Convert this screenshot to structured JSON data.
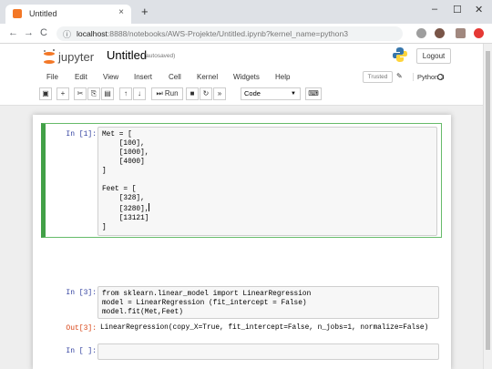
{
  "browser": {
    "tab_title": "Untitled",
    "tab_close": "×",
    "new_tab": "+",
    "window_controls": [
      "–",
      "☐",
      "✕"
    ],
    "url_prefix": "localhost",
    "url_rest": ":8888/notebooks/AWS-Projekte/Untitled.ipynb?kernel_name=python3",
    "nav": {
      "back": "←",
      "forward": "→",
      "reload": "C"
    }
  },
  "jupyter": {
    "logo_text": "jupyter",
    "title": "Untitled",
    "autosave": "(autosaved)",
    "logout": "Logout",
    "menu": [
      "File",
      "Edit",
      "View",
      "Insert",
      "Cell",
      "Kernel",
      "Widgets",
      "Help"
    ],
    "trusted": "Trusted",
    "kernel": "Python 3",
    "toolbar": {
      "run_label": "Run",
      "cell_type": "Code"
    }
  },
  "cells": [
    {
      "prompt": "In [1]:",
      "lines": [
        "Met = [",
        "    [100],",
        "    [1000],",
        "    [4000]",
        "]",
        "",
        "Feet = [",
        "    [328],",
        "    [3280],",
        "    [13121]",
        "]"
      ]
    },
    {
      "prompt": "In [3]:",
      "lines": [
        "from sklearn.linear_model import LinearRegression",
        "model = LinearRegression (fit_intercept = False)",
        "model.fit(Met,Feet)"
      ],
      "out_prompt": "Out[3]:",
      "output": "LinearRegression(copy_X=True, fit_intercept=False, n_jobs=1, normalize=False)"
    },
    {
      "prompt": "In [ ]:"
    }
  ],
  "colors": {
    "accent_orange": "#f37726",
    "selected_green": "#42a047",
    "prompt_in": "#303f9f",
    "prompt_out": "#d84315"
  }
}
